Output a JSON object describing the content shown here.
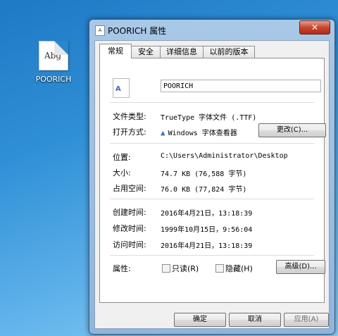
{
  "desktop": {
    "icon_label": "POORICH",
    "icon_glyph": "Abg"
  },
  "window": {
    "title": "POORICH 属性",
    "title_icon_glyph": "A",
    "close_glyph": "✕"
  },
  "tabs": [
    {
      "label": "常规"
    },
    {
      "label": "安全"
    },
    {
      "label": "详细信息"
    },
    {
      "label": "以前的版本"
    }
  ],
  "general": {
    "file_icon_glyph": "A",
    "file_name": "POORICH",
    "type_label": "文件类型:",
    "type_value": "TrueType 字体文件 (.TTF)",
    "opens_label": "打开方式:",
    "opens_value": "Windows 字体查看器",
    "change_button": "更改(C)...",
    "location_label": "位置:",
    "location_value": "C:\\Users\\Administrator\\Desktop",
    "size_label": "大小:",
    "size_value": "74.7 KB (76,588 字节)",
    "size_on_disk_label": "占用空间:",
    "size_on_disk_value": "76.0 KB (77,824 字节)",
    "created_label": "创建时间:",
    "created_value": "2016年4月21日，13:18:39",
    "modified_label": "修改时间:",
    "modified_value": "1999年10月15日，9:56:04",
    "accessed_label": "访问时间:",
    "accessed_value": "2016年4月21日，13:18:39",
    "attributes_label": "属性:",
    "readonly_label": "只读(R)",
    "hidden_label": "隐藏(H)",
    "advanced_button": "高级(D)..."
  },
  "footer": {
    "ok": "确定",
    "cancel": "取消",
    "apply": "应用(A)"
  }
}
